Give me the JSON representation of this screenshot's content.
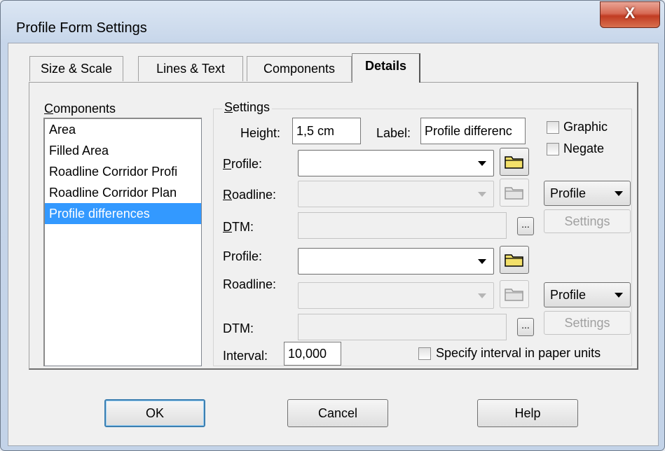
{
  "window": {
    "title": "Profile Form Settings",
    "close_glyph": "X"
  },
  "tabs": [
    "Size & Scale",
    "Lines & Text",
    "Components",
    "Details"
  ],
  "active_tab": "Details",
  "components": {
    "label_first": "C",
    "label_rest": "omponents",
    "items": [
      "Area",
      "Filled Area",
      "Roadline Corridor Profi",
      "Roadline Corridor Plan",
      "Profile differences"
    ],
    "selected": "Profile differences"
  },
  "settings": {
    "group_label_first": "S",
    "group_label_rest": "ettings",
    "height_label": "Height:",
    "height_value": "1,5 cm",
    "label_label": "Label:",
    "label_value": "Profile differenc",
    "graphic_label": "Graphic",
    "negate_label": "Negate",
    "first": {
      "profile_label_first": "P",
      "profile_label_rest": "rofile:",
      "roadline_label_first": "R",
      "roadline_label_rest": "oadline:",
      "dtm_label_first": "D",
      "dtm_label_rest": "TM:",
      "profile_value": "",
      "roadline_value": "",
      "dtm_value": "",
      "mode_value": "Profile",
      "settings_button": "Settings",
      "browse_button": "..."
    },
    "second": {
      "profile_label": "Profile:",
      "roadline_label": "Roadline:",
      "dtm_label": "DTM:",
      "profile_value": "",
      "roadline_value": "",
      "dtm_value": "",
      "mode_value": "Profile",
      "settings_button": "Settings",
      "browse_button": "..."
    },
    "interval_label": "Interval:",
    "interval_value": "10,000",
    "paper_units_label": "Specify interval in paper units"
  },
  "buttons": {
    "ok": "OK",
    "cancel": "Cancel",
    "help": "Help"
  },
  "colors": {
    "selection": "#3399ff",
    "close_button": "#c94b31",
    "folder_fill": "#f3e06a"
  }
}
